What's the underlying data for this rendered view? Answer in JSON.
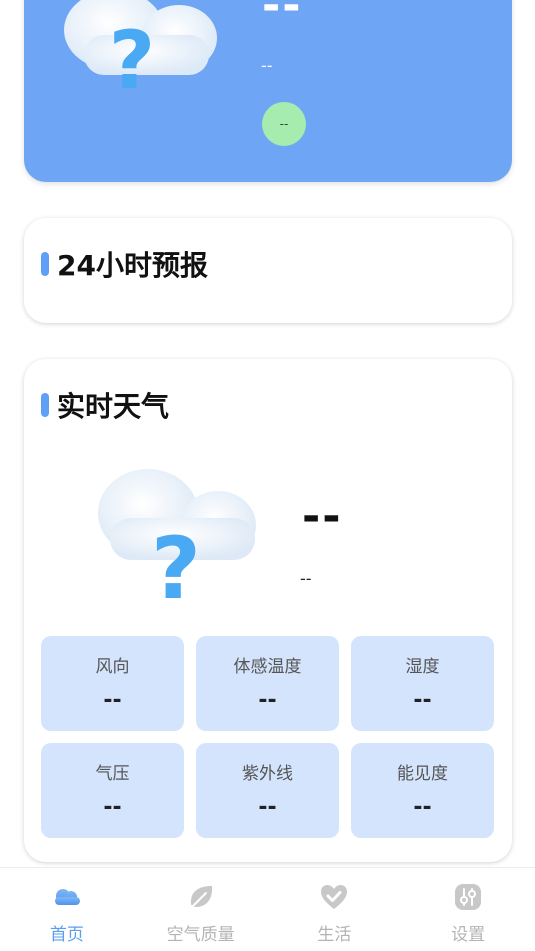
{
  "current": {
    "temperature": "--",
    "description": "--",
    "aqi": "--"
  },
  "forecast": {
    "title": "24小时预报"
  },
  "realtime": {
    "title": "实时天气",
    "temperature": "--",
    "description": "--",
    "metrics": [
      {
        "label": "风向",
        "value": "--"
      },
      {
        "label": "体感温度",
        "value": "--"
      },
      {
        "label": "湿度",
        "value": "--"
      },
      {
        "label": "气压",
        "value": "--"
      },
      {
        "label": "紫外线",
        "value": "--"
      },
      {
        "label": "能见度",
        "value": "--"
      }
    ]
  },
  "nav": {
    "items": [
      {
        "label": "首页",
        "icon": "cloud-icon",
        "active": true
      },
      {
        "label": "空气质量",
        "icon": "leaf-icon",
        "active": false
      },
      {
        "label": "生活",
        "icon": "heart-check-icon",
        "active": false
      },
      {
        "label": "设置",
        "icon": "sliders-icon",
        "active": false
      }
    ]
  },
  "colors": {
    "primary": "#6ea5f4",
    "accent": "#5fa0f7",
    "metric_bg": "#d3e4fc",
    "aqi_badge": "#a6ecae",
    "nav_active": "#5a9ef2",
    "nav_inactive": "#b4b4b4"
  }
}
